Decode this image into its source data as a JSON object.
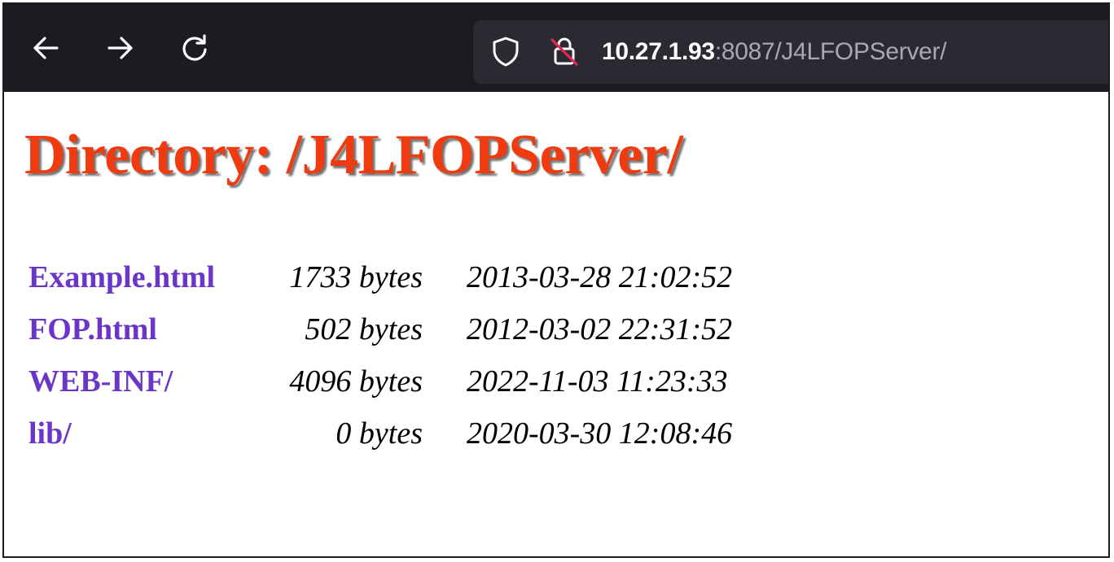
{
  "toolbar": {
    "back_icon": "back-arrow-icon",
    "forward_icon": "forward-arrow-icon",
    "reload_icon": "reload-icon",
    "shield_icon": "shield-icon",
    "insecure_lock_icon": "insecure-lock-icon",
    "url_host": "10.27.1.93",
    "url_rest": ":8087/J4LFOPServer/"
  },
  "page": {
    "heading": "Directory: /J4LFOPServer/",
    "entries": [
      {
        "name": "Example.html",
        "size": "1733 bytes",
        "modified": "2013-03-28 21:02:52"
      },
      {
        "name": "FOP.html",
        "size": "502 bytes",
        "modified": "2012-03-02 22:31:52"
      },
      {
        "name": "WEB-INF/",
        "size": "4096 bytes",
        "modified": "2022-11-03 11:23:33"
      },
      {
        "name": "lib/",
        "size": "0 bytes",
        "modified": "2020-03-30 12:08:46"
      }
    ]
  },
  "colors": {
    "toolbar_bg": "#1c1b22",
    "url_bar_bg": "#2b2a33",
    "heading": "#ef3b0f",
    "link": "#6b35c8"
  }
}
